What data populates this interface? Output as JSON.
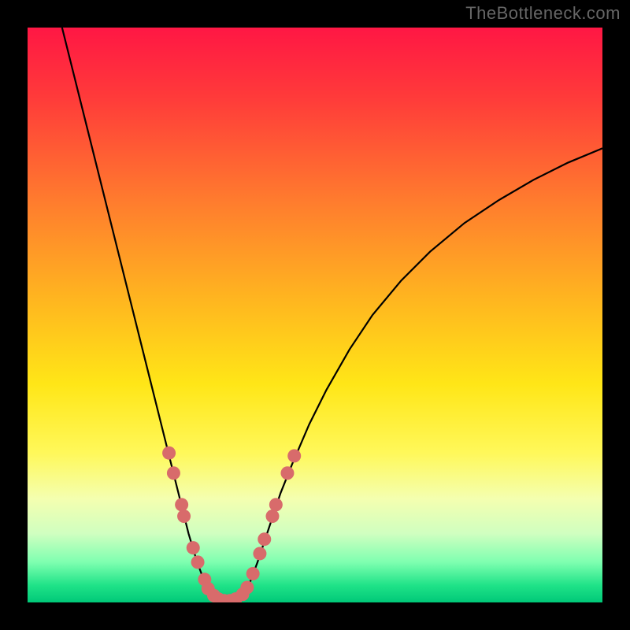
{
  "watermark": "TheBottleneck.com",
  "chart_data": {
    "type": "line",
    "title": "",
    "xlabel": "",
    "ylabel": "",
    "xlim": [
      0,
      100
    ],
    "ylim": [
      0,
      100
    ],
    "background_gradient": {
      "stops": [
        {
          "offset": 0,
          "color": "#ff1744"
        },
        {
          "offset": 12,
          "color": "#ff3a3a"
        },
        {
          "offset": 30,
          "color": "#ff7b2e"
        },
        {
          "offset": 48,
          "color": "#ffb81f"
        },
        {
          "offset": 62,
          "color": "#ffe617"
        },
        {
          "offset": 74,
          "color": "#fff85a"
        },
        {
          "offset": 82,
          "color": "#f4ffb0"
        },
        {
          "offset": 88,
          "color": "#d0ffc0"
        },
        {
          "offset": 93,
          "color": "#7effb0"
        },
        {
          "offset": 97,
          "color": "#20e388"
        },
        {
          "offset": 100,
          "color": "#00c878"
        }
      ]
    },
    "series": [
      {
        "name": "bottleneck-curve",
        "points": [
          {
            "x": 6,
            "y": 100
          },
          {
            "x": 8,
            "y": 92
          },
          {
            "x": 10,
            "y": 84
          },
          {
            "x": 12,
            "y": 76
          },
          {
            "x": 14,
            "y": 68
          },
          {
            "x": 16,
            "y": 60
          },
          {
            "x": 18,
            "y": 52
          },
          {
            "x": 20,
            "y": 44
          },
          {
            "x": 22,
            "y": 36
          },
          {
            "x": 23.5,
            "y": 30
          },
          {
            "x": 25,
            "y": 24
          },
          {
            "x": 26.5,
            "y": 18
          },
          {
            "x": 28,
            "y": 12
          },
          {
            "x": 29.5,
            "y": 7
          },
          {
            "x": 31,
            "y": 3
          },
          {
            "x": 32.5,
            "y": 1
          },
          {
            "x": 34,
            "y": 0.3
          },
          {
            "x": 35.5,
            "y": 0.3
          },
          {
            "x": 37,
            "y": 1
          },
          {
            "x": 38.5,
            "y": 3
          },
          {
            "x": 40,
            "y": 7
          },
          {
            "x": 42,
            "y": 13
          },
          {
            "x": 44,
            "y": 19
          },
          {
            "x": 46,
            "y": 24
          },
          {
            "x": 49,
            "y": 31
          },
          {
            "x": 52,
            "y": 37
          },
          {
            "x": 56,
            "y": 44
          },
          {
            "x": 60,
            "y": 50
          },
          {
            "x": 65,
            "y": 56
          },
          {
            "x": 70,
            "y": 61
          },
          {
            "x": 76,
            "y": 66
          },
          {
            "x": 82,
            "y": 70
          },
          {
            "x": 88,
            "y": 73.5
          },
          {
            "x": 94,
            "y": 76.5
          },
          {
            "x": 100,
            "y": 79
          }
        ]
      }
    ],
    "markers": [
      {
        "x": 24.6,
        "y": 26
      },
      {
        "x": 25.4,
        "y": 22.5
      },
      {
        "x": 26.8,
        "y": 17
      },
      {
        "x": 27.2,
        "y": 15
      },
      {
        "x": 28.8,
        "y": 9.5
      },
      {
        "x": 29.6,
        "y": 7
      },
      {
        "x": 30.8,
        "y": 4
      },
      {
        "x": 31.4,
        "y": 2.4
      },
      {
        "x": 32.4,
        "y": 1.2
      },
      {
        "x": 33.2,
        "y": 0.6
      },
      {
        "x": 34.2,
        "y": 0.3
      },
      {
        "x": 35.2,
        "y": 0.3
      },
      {
        "x": 36.2,
        "y": 0.6
      },
      {
        "x": 37.4,
        "y": 1.4
      },
      {
        "x": 38.2,
        "y": 2.6
      },
      {
        "x": 39.2,
        "y": 5
      },
      {
        "x": 40.4,
        "y": 8.5
      },
      {
        "x": 41.2,
        "y": 11
      },
      {
        "x": 42.6,
        "y": 15
      },
      {
        "x": 43.2,
        "y": 17
      },
      {
        "x": 45.2,
        "y": 22.5
      },
      {
        "x": 46.4,
        "y": 25.5
      }
    ],
    "marker_color": "#d86b6b",
    "curve_color": "#000000"
  }
}
